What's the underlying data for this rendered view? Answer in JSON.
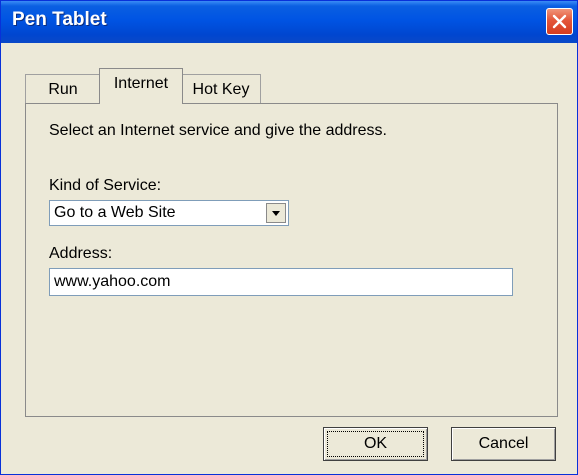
{
  "window": {
    "title": "Pen Tablet"
  },
  "tabs": [
    {
      "label": "Run",
      "active": false
    },
    {
      "label": "Internet",
      "active": true
    },
    {
      "label": "Hot Key",
      "active": false
    }
  ],
  "internet": {
    "description": "Select an Internet service and give the address.",
    "service_label": "Kind of Service:",
    "service_value": "Go to a Web Site",
    "address_label": "Address:",
    "address_value": "www.yahoo.com"
  },
  "buttons": {
    "ok": "OK",
    "cancel": "Cancel"
  },
  "icons": {
    "close": "close-icon",
    "dropdown": "chevron-down-icon"
  },
  "colors": {
    "titlebar": "#0054e3",
    "close": "#e3563a",
    "face": "#ece9d8"
  }
}
